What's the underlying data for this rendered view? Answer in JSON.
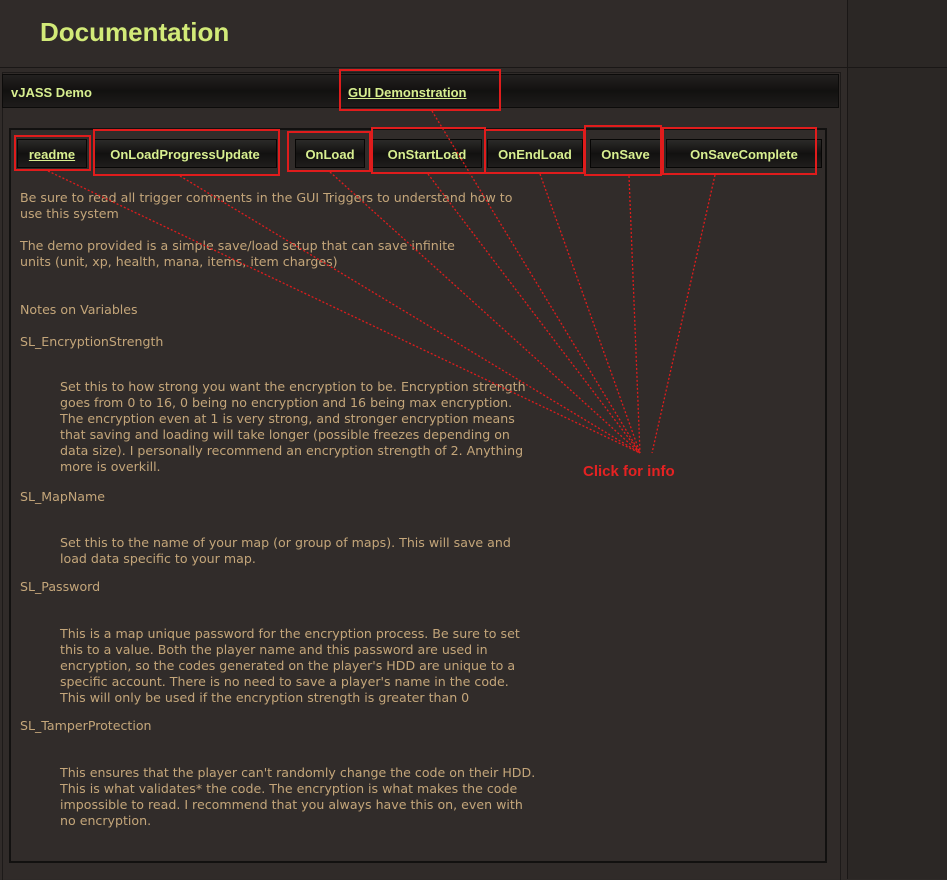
{
  "page": {
    "title": "Documentation"
  },
  "tabbar": {
    "left_tab": "vJASS Demo",
    "right_tab": "GUI Demonstration"
  },
  "buttons": [
    {
      "label": "readme"
    },
    {
      "label": "OnLoadProgressUpdate"
    },
    {
      "label": "OnLoad"
    },
    {
      "label": "OnStartLoad"
    },
    {
      "label": "OnEndLoad"
    },
    {
      "label": "OnSave"
    },
    {
      "label": "OnSaveComplete"
    }
  ],
  "content": {
    "intro1": "Be sure to read all trigger comments in the GUI Triggers to understand how to\nuse this system",
    "intro2": "The demo provided is a simple save/load setup that can save infinite\nunits (unit, xp, health, mana, items, item charges)",
    "notes_heading": "Notes on Variables",
    "var1_name": "SL_EncryptionStrength",
    "var1_desc": "Set this to how strong you want the encryption to be. Encryption strength\ngoes from 0 to 16, 0 being no encryption and 16 being max encryption.\nThe encryption even at 1 is very strong, and stronger encryption means\nthat saving and loading will take longer (possible freezes depending on\ndata size). I personally recommend an encryption strength of 2. Anything\nmore is overkill.",
    "var2_name": "SL_MapName",
    "var2_desc": "Set this to the name of your map (or group of maps). This will save and\nload data specific to your map.",
    "var3_name": "SL_Password",
    "var3_desc": "This is a map unique password for the encryption process. Be sure to set\nthis to a value. Both the player name and this password are used in\nencryption, so the codes generated on the player's HDD are unique to a\nspecific account. There is no need to save a player's name in the code.\nThis will only be used if the encryption strength is greater than 0",
    "var4_name": "SL_TamperProtection",
    "var4_desc": "This ensures that the player can't randomly change the code on their HDD.\nThis is what validates* the code. The encryption is what makes the code\nimpossible to read. I recommend that you always have this on, even with\nno encryption."
  },
  "annotation": {
    "label": "Click for info",
    "color": "#e01c1c"
  }
}
